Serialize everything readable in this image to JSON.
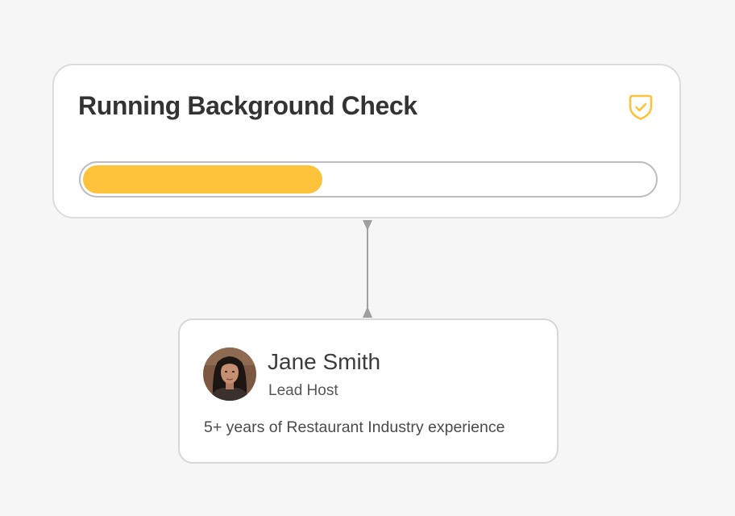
{
  "check": {
    "title": "Running Background Check",
    "icon": "shield-check-icon",
    "progress_percent": 42
  },
  "person": {
    "name": "Jane Smith",
    "role": "Lead Host",
    "bio": "5+ years of Restaurant Industry experience",
    "avatar_icon": "avatar-photo"
  },
  "colors": {
    "accent": "#fec33a",
    "background": "#f6f6f6",
    "card": "#ffffff",
    "connector": "#9e9e9e"
  }
}
